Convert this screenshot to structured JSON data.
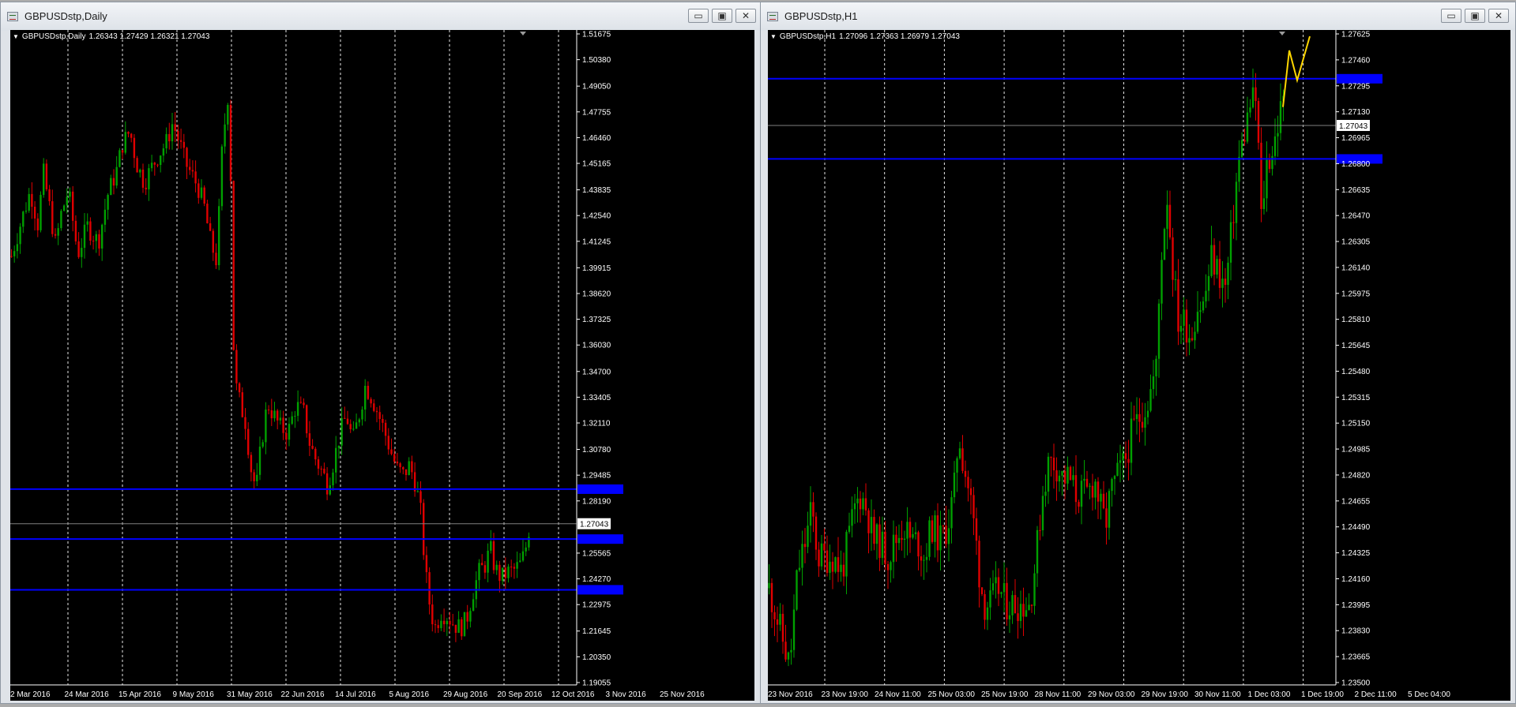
{
  "windows": [
    {
      "title": "GBPUSDstp,Daily",
      "header": {
        "symbol": "GBPUSDstp,Daily",
        "quote": "1.26343 1.27429 1.26321 1.27043"
      },
      "controls": {
        "minimize": "▭",
        "restore": "▣",
        "close": "✕"
      }
    },
    {
      "title": "GBPUSDstp,H1",
      "header": {
        "symbol": "GBPUSDstp,H1",
        "quote": "1.27096 1.27363 1.26979 1.27043"
      },
      "controls": {
        "minimize": "▭",
        "restore": "▣",
        "close": "✕"
      }
    }
  ],
  "colors": {
    "background": "#000000",
    "bull": "#00a000",
    "bear": "#e00000",
    "level": "#0000ff",
    "price_line": "#808080",
    "drawing": "#ffd700",
    "grid": "#ffffff",
    "text": "#ffffff"
  },
  "chart_data": [
    {
      "type": "candlestick",
      "symbol": "GBPUSDstp",
      "timeframe": "Daily",
      "y_ticks": [
        "1.51675",
        "1.50380",
        "1.49050",
        "1.47755",
        "1.46460",
        "1.45165",
        "1.43835",
        "1.42540",
        "1.41245",
        "1.39915",
        "1.38620",
        "1.37325",
        "1.36030",
        "1.34700",
        "1.33405",
        "1.32110",
        "1.30780",
        "1.29485",
        "1.28190",
        "1.25565",
        "1.24270",
        "1.22975",
        "1.21645",
        "1.20350",
        "1.19055"
      ],
      "ylim": [
        1.19055,
        1.51675
      ],
      "x_ticks": [
        "2 Mar 2016",
        "24 Mar 2016",
        "15 Apr 2016",
        "9 May 2016",
        "31 May 2016",
        "22 Jun 2016",
        "14 Jul 2016",
        "5 Aug 2016",
        "29 Aug 2016",
        "20 Sep 2016",
        "12 Oct 2016",
        "3 Nov 2016",
        "25 Nov 2016"
      ],
      "current_price": "1.27043",
      "horizontal_levels": [
        1.2878,
        1.2627,
        1.2372
      ],
      "close_path": [
        [
          0,
          1.405
        ],
        [
          12,
          1.422
        ],
        [
          24,
          1.438
        ],
        [
          34,
          1.42
        ],
        [
          40,
          1.448
        ],
        [
          48,
          1.43
        ],
        [
          56,
          1.41
        ],
        [
          62,
          1.425
        ],
        [
          72,
          1.438
        ],
        [
          84,
          1.406
        ],
        [
          96,
          1.42
        ],
        [
          110,
          1.412
        ],
        [
          122,
          1.436
        ],
        [
          134,
          1.449
        ],
        [
          140,
          1.461
        ],
        [
          150,
          1.468
        ],
        [
          158,
          1.452
        ],
        [
          168,
          1.442
        ],
        [
          178,
          1.45
        ],
        [
          186,
          1.456
        ],
        [
          196,
          1.462
        ],
        [
          204,
          1.472
        ],
        [
          212,
          1.463
        ],
        [
          220,
          1.452
        ],
        [
          228,
          1.446
        ],
        [
          236,
          1.44
        ],
        [
          244,
          1.43
        ],
        [
          252,
          1.412
        ],
        [
          260,
          1.402
        ],
        [
          266,
          1.455
        ],
        [
          272,
          1.48
        ],
        [
          276,
          1.492
        ],
        [
          280,
          1.368
        ],
        [
          284,
          1.34
        ],
        [
          290,
          1.33
        ],
        [
          296,
          1.322
        ],
        [
          304,
          1.296
        ],
        [
          310,
          1.288
        ],
        [
          316,
          1.31
        ],
        [
          324,
          1.331
        ],
        [
          332,
          1.325
        ],
        [
          340,
          1.319
        ],
        [
          350,
          1.316
        ],
        [
          360,
          1.33
        ],
        [
          370,
          1.326
        ],
        [
          378,
          1.31
        ],
        [
          386,
          1.302
        ],
        [
          394,
          1.296
        ],
        [
          400,
          1.29
        ],
        [
          408,
          1.302
        ],
        [
          416,
          1.316
        ],
        [
          424,
          1.325
        ],
        [
          432,
          1.312
        ],
        [
          440,
          1.325
        ],
        [
          448,
          1.34
        ],
        [
          456,
          1.334
        ],
        [
          464,
          1.326
        ],
        [
          472,
          1.317
        ],
        [
          480,
          1.307
        ],
        [
          488,
          1.298
        ],
        [
          496,
          1.295
        ],
        [
          504,
          1.3
        ],
        [
          512,
          1.29
        ],
        [
          518,
          1.276
        ],
        [
          524,
          1.246
        ],
        [
          530,
          1.228
        ],
        [
          536,
          1.218
        ],
        [
          544,
          1.226
        ],
        [
          552,
          1.224
        ],
        [
          560,
          1.22
        ],
        [
          568,
          1.218
        ],
        [
          576,
          1.222
        ],
        [
          584,
          1.236
        ],
        [
          592,
          1.246
        ],
        [
          600,
          1.25
        ],
        [
          606,
          1.258
        ],
        [
          612,
          1.248
        ],
        [
          620,
          1.243
        ],
        [
          628,
          1.246
        ],
        [
          636,
          1.247
        ],
        [
          644,
          1.25
        ],
        [
          650,
          1.256
        ],
        [
          656,
          1.27
        ]
      ]
    },
    {
      "type": "candlestick",
      "symbol": "GBPUSDstp",
      "timeframe": "H1",
      "y_ticks": [
        "1.27625",
        "1.27460",
        "1.27295",
        "1.27130",
        "1.26965",
        "1.26800",
        "1.26635",
        "1.26470",
        "1.26305",
        "1.26140",
        "1.25975",
        "1.25810",
        "1.25645",
        "1.25480",
        "1.25315",
        "1.25150",
        "1.24985",
        "1.24820",
        "1.24655",
        "1.24490",
        "1.24325",
        "1.24160",
        "1.23995",
        "1.23830",
        "1.23665",
        "1.23500"
      ],
      "ylim": [
        1.235,
        1.27625
      ],
      "x_ticks": [
        "23 Nov 2016",
        "23 Nov 19:00",
        "24 Nov 11:00",
        "25 Nov 03:00",
        "25 Nov 19:00",
        "28 Nov 11:00",
        "29 Nov 03:00",
        "29 Nov 19:00",
        "30 Nov 11:00",
        "1 Dec 03:00",
        "1 Dec 19:00",
        "2 Dec 11:00",
        "5 Dec 04:00"
      ],
      "current_price": "1.27043",
      "horizontal_levels": [
        1.2734,
        1.2683
      ],
      "close_path": [
        [
          0,
          1.241
        ],
        [
          16,
          1.238
        ],
        [
          26,
          1.236
        ],
        [
          36,
          1.242
        ],
        [
          46,
          1.244
        ],
        [
          54,
          1.246
        ],
        [
          62,
          1.243
        ],
        [
          72,
          1.243
        ],
        [
          82,
          1.243
        ],
        [
          92,
          1.242
        ],
        [
          100,
          1.244
        ],
        [
          108,
          1.246
        ],
        [
          116,
          1.247
        ],
        [
          124,
          1.246
        ],
        [
          132,
          1.244
        ],
        [
          140,
          1.244
        ],
        [
          150,
          1.243
        ],
        [
          160,
          1.244
        ],
        [
          170,
          1.245
        ],
        [
          180,
          1.244
        ],
        [
          188,
          1.244
        ],
        [
          196,
          1.243
        ],
        [
          206,
          1.245
        ],
        [
          216,
          1.244
        ],
        [
          226,
          1.245
        ],
        [
          234,
          1.247
        ],
        [
          240,
          1.251
        ],
        [
          246,
          1.249
        ],
        [
          254,
          1.247
        ],
        [
          262,
          1.244
        ],
        [
          266,
          1.242
        ],
        [
          272,
          1.24
        ],
        [
          280,
          1.24
        ],
        [
          290,
          1.241
        ],
        [
          300,
          1.24
        ],
        [
          310,
          1.24
        ],
        [
          320,
          1.24
        ],
        [
          330,
          1.24
        ],
        [
          338,
          1.243
        ],
        [
          346,
          1.247
        ],
        [
          354,
          1.249
        ],
        [
          362,
          1.249
        ],
        [
          372,
          1.248
        ],
        [
          380,
          1.248
        ],
        [
          388,
          1.247
        ],
        [
          396,
          1.247
        ],
        [
          404,
          1.247
        ],
        [
          412,
          1.248
        ],
        [
          420,
          1.246
        ],
        [
          426,
          1.245
        ],
        [
          432,
          1.247
        ],
        [
          440,
          1.248
        ],
        [
          450,
          1.249
        ],
        [
          460,
          1.251
        ],
        [
          470,
          1.252
        ],
        [
          480,
          1.253
        ],
        [
          490,
          1.255
        ],
        [
          496,
          1.262
        ],
        [
          504,
          1.266
        ],
        [
          510,
          1.262
        ],
        [
          518,
          1.258
        ],
        [
          526,
          1.258
        ],
        [
          534,
          1.257
        ],
        [
          542,
          1.259
        ],
        [
          550,
          1.259
        ],
        [
          560,
          1.262
        ],
        [
          570,
          1.261
        ],
        [
          578,
          1.26
        ],
        [
          586,
          1.264
        ],
        [
          594,
          1.268
        ],
        [
          602,
          1.27
        ],
        [
          610,
          1.272
        ],
        [
          618,
          1.272
        ],
        [
          622,
          1.264
        ],
        [
          630,
          1.268
        ],
        [
          638,
          1.269
        ],
        [
          646,
          1.271
        ],
        [
          652,
          1.272
        ]
      ],
      "drawing": [
        [
          652,
          1.2716
        ],
        [
          660,
          1.2752
        ],
        [
          670,
          1.2733
        ],
        [
          686,
          1.2761
        ]
      ]
    }
  ]
}
